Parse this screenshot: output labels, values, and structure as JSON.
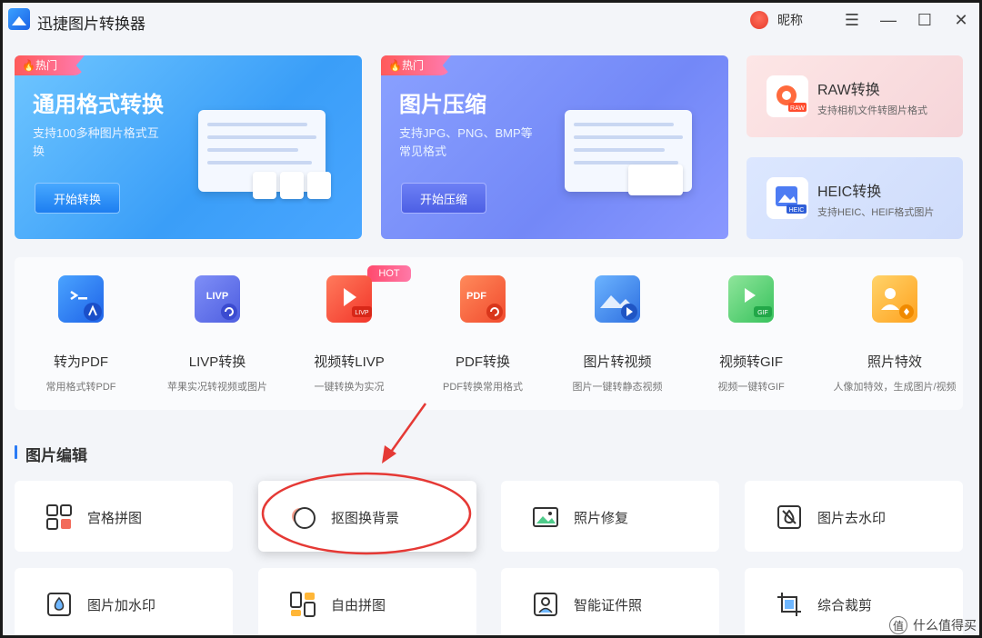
{
  "app": {
    "title": "迅捷图片转换器",
    "nickname": "昵称"
  },
  "window_controls": {
    "menu": "☰",
    "minimize": "—",
    "maximize": "☐",
    "close": "✕"
  },
  "banners": [
    {
      "tag": "🔥热门",
      "title": "通用格式转换",
      "desc": "支持100多种图片格式互换",
      "button": "开始转换"
    },
    {
      "tag": "🔥热门",
      "title": "图片压缩",
      "desc": "支持JPG、PNG、BMP等常见格式",
      "button": "开始压缩"
    }
  ],
  "side_cards": [
    {
      "title": "RAW转换",
      "desc": "支持相机文件转图片格式",
      "badge": "RAW"
    },
    {
      "title": "HEIC转换",
      "desc": "支持HEIC、HEIF格式图片",
      "badge": "HEIC"
    }
  ],
  "tools": [
    {
      "name": "转为PDF",
      "desc": "常用格式转PDF",
      "color": "#2e7bf6"
    },
    {
      "name": "LIVP转换",
      "desc": "苹果实况转视频或图片",
      "color": "#5b6de8",
      "icon_text": "LIVP"
    },
    {
      "name": "视频转LIVP",
      "desc": "一键转换为实况",
      "color": "#ff4b3a",
      "icon_text": "LIVP"
    },
    {
      "name": "PDF转换",
      "desc": "PDF转换常用格式",
      "color": "#ff5a3c",
      "icon_text": "PDF"
    },
    {
      "name": "图片转视频",
      "desc": "图片一键转静态视频",
      "color": "#3b8cf0"
    },
    {
      "name": "视频转GIF",
      "desc": "视频一键转GIF",
      "color": "#4ecb6a",
      "icon_text": "GIF"
    },
    {
      "name": "照片特效",
      "desc": "人像加特效，生成图片/视频",
      "color": "#ffb637"
    }
  ],
  "tool_hot_badge": "HOT",
  "section": {
    "title": "图片编辑"
  },
  "edit_tools": [
    {
      "label": "宫格拼图"
    },
    {
      "label": "抠图换背景"
    },
    {
      "label": "照片修复"
    },
    {
      "label": "图片去水印"
    },
    {
      "label": "图片加水印"
    },
    {
      "label": "自由拼图"
    },
    {
      "label": "智能证件照"
    },
    {
      "label": "综合裁剪"
    }
  ],
  "watermark": {
    "text": "什么值得买",
    "icon": "值"
  },
  "colors": {
    "accent": "#2a7bf5",
    "annotation": "#e53935"
  }
}
